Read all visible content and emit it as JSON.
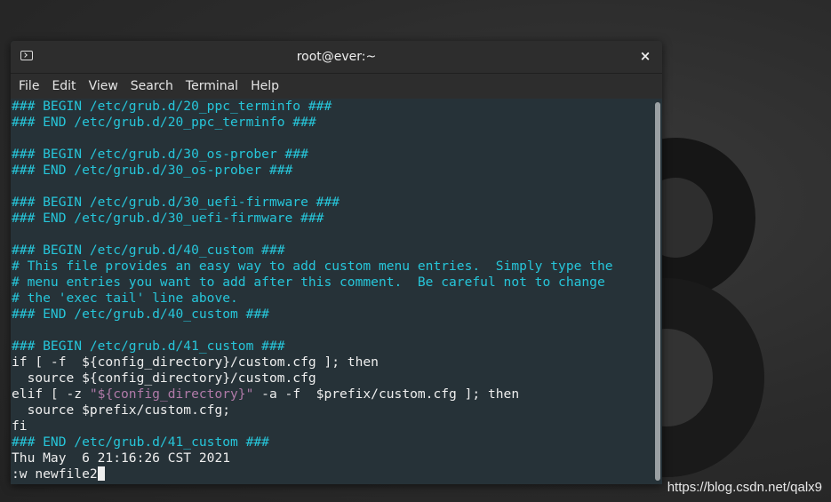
{
  "window": {
    "title": "root@ever:~",
    "close_label": "×"
  },
  "menu": [
    "File",
    "Edit",
    "View",
    "Search",
    "Terminal",
    "Help"
  ],
  "terminal": {
    "lines": [
      {
        "segments": [
          {
            "text": "### BEGIN /etc/grub.d/20_ppc_terminfo ###",
            "color": "cyan"
          }
        ]
      },
      {
        "segments": [
          {
            "text": "### END /etc/grub.d/20_ppc_terminfo ###",
            "color": "cyan"
          }
        ]
      },
      {
        "segments": []
      },
      {
        "segments": [
          {
            "text": "### BEGIN /etc/grub.d/30_os-prober ###",
            "color": "cyan"
          }
        ]
      },
      {
        "segments": [
          {
            "text": "### END /etc/grub.d/30_os-prober ###",
            "color": "cyan"
          }
        ]
      },
      {
        "segments": []
      },
      {
        "segments": [
          {
            "text": "### BEGIN /etc/grub.d/30_uefi-firmware ###",
            "color": "cyan"
          }
        ]
      },
      {
        "segments": [
          {
            "text": "### END /etc/grub.d/30_uefi-firmware ###",
            "color": "cyan"
          }
        ]
      },
      {
        "segments": []
      },
      {
        "segments": [
          {
            "text": "### BEGIN /etc/grub.d/40_custom ###",
            "color": "cyan"
          }
        ]
      },
      {
        "segments": [
          {
            "text": "# This file provides an easy way to add custom menu entries.  Simply type the",
            "color": "cyan"
          }
        ]
      },
      {
        "segments": [
          {
            "text": "# menu entries you want to add after this comment.  Be careful not to change",
            "color": "cyan"
          }
        ]
      },
      {
        "segments": [
          {
            "text": "# the 'exec tail' line above.",
            "color": "cyan"
          }
        ]
      },
      {
        "segments": [
          {
            "text": "### END /etc/grub.d/40_custom ###",
            "color": "cyan"
          }
        ]
      },
      {
        "segments": []
      },
      {
        "segments": [
          {
            "text": "### BEGIN /etc/grub.d/41_custom ###",
            "color": "cyan"
          }
        ]
      },
      {
        "segments": [
          {
            "text": "if [ -f  ${config_directory}/custom.cfg ]; then",
            "color": "white"
          }
        ]
      },
      {
        "segments": [
          {
            "text": "  source ${config_directory}/custom.cfg",
            "color": "white"
          }
        ]
      },
      {
        "segments": [
          {
            "text": "elif [ -z ",
            "color": "white"
          },
          {
            "text": "\"${config_directory}\"",
            "color": "purple"
          },
          {
            "text": " -a -f  $prefix/custom.cfg ]; then",
            "color": "white"
          }
        ]
      },
      {
        "segments": [
          {
            "text": "  source $prefix/custom.cfg;",
            "color": "white"
          }
        ]
      },
      {
        "segments": [
          {
            "text": "fi",
            "color": "white"
          }
        ]
      },
      {
        "segments": [
          {
            "text": "### END /etc/grub.d/41_custom ###",
            "color": "cyan"
          }
        ]
      },
      {
        "segments": [
          {
            "text": "Thu May  6 21:16:26 CST 2021",
            "color": "white"
          }
        ]
      }
    ],
    "command_line": ":w newfile2"
  },
  "colors": {
    "terminal_bg": "#263238",
    "cyan": "#26c6da",
    "white": "#eeeeee",
    "purple": "#b07aa8",
    "titlebar_bg": "#2d2d2d"
  },
  "watermark": "https://blog.csdn.net/qalx9"
}
